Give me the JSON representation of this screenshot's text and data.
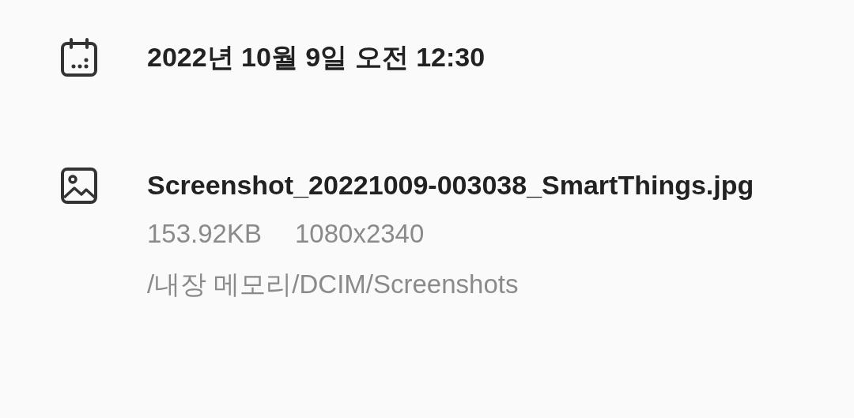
{
  "date": {
    "text": "2022년 10월 9일 오전 12:30"
  },
  "file": {
    "name": "Screenshot_20221009-003038_SmartThings.jpg",
    "size": "153.92KB",
    "resolution": "1080x2340",
    "path": "/내장 메모리/DCIM/Screenshots"
  }
}
